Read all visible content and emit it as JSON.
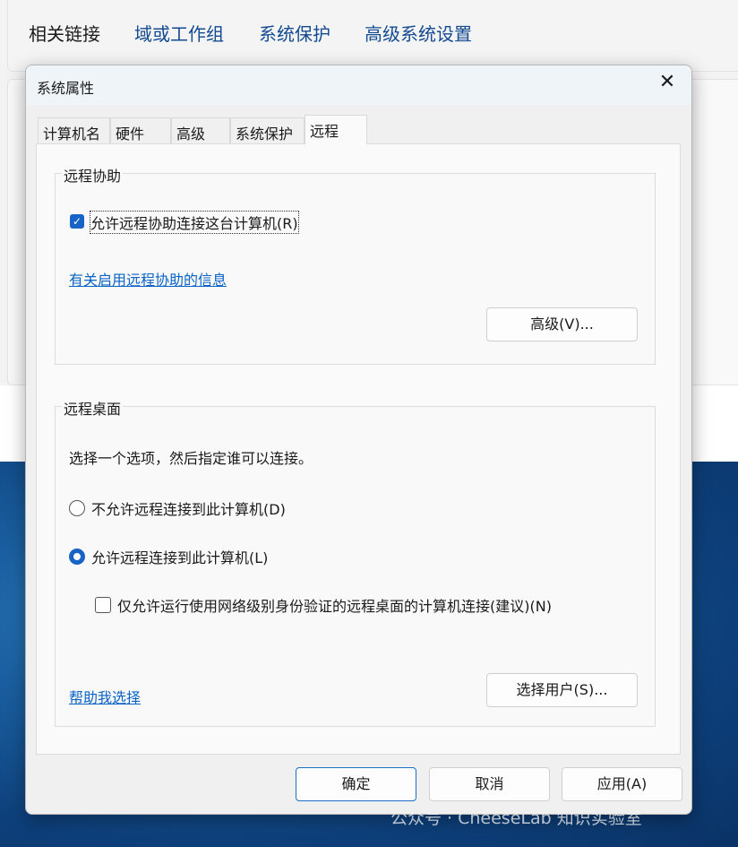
{
  "background": {
    "related_links_label": "相关链接",
    "links": [
      "域或工作组",
      "系统保护",
      "高级系统设置"
    ]
  },
  "dialog": {
    "title": "系统属性",
    "close_icon": "close-icon",
    "tabs": [
      "计算机名",
      "硬件",
      "高级",
      "系统保护",
      "远程"
    ],
    "active_tab": "远程",
    "remote_assistance": {
      "title": "远程协助",
      "allow_label": "允许远程协助连接这台计算机(R)",
      "allow_checked": true,
      "info_link": "有关启用远程协助的信息",
      "advanced_button": "高级(V)..."
    },
    "remote_desktop": {
      "title": "远程桌面",
      "instruction": "选择一个选项，然后指定谁可以连接。",
      "option_deny": "不允许远程连接到此计算机(D)",
      "option_allow": "允许远程连接到此计算机(L)",
      "selected": "option_allow",
      "nla_label": "仅允许运行使用网络级别身份验证的远程桌面的计算机连接(建议)(N)",
      "nla_checked": false,
      "help_link": "帮助我选择",
      "select_users_button": "选择用户(S)..."
    },
    "buttons": {
      "ok": "确定",
      "cancel": "取消",
      "apply": "应用(A)"
    }
  },
  "watermark": "公众号 · CheeseLab 知识实验室",
  "colors": {
    "accent": "#1864c6",
    "link": "#0b63c5"
  }
}
